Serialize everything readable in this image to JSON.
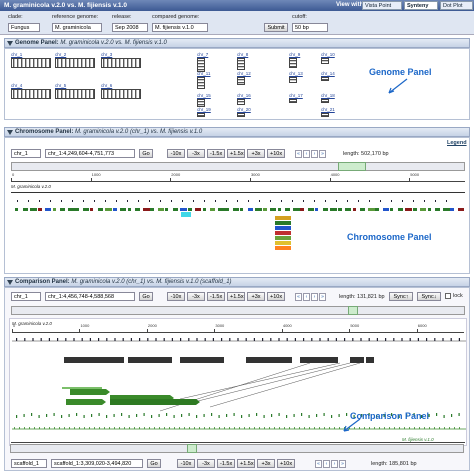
{
  "topbar": {
    "title": "M. graminicola v.2.0 vs. M. fijiensis v.1.0",
    "view_with": "View with:",
    "vista_point": "Vista Point",
    "synteny": "Synteny",
    "dot_plot": "Dot Plot"
  },
  "controls": {
    "clade_label": "clade:",
    "clade_value": "Fungus",
    "ref_label": "reference genome:",
    "ref_value": "M. graminicola",
    "release_label": "release:",
    "release_value": "Sep 2008",
    "compared_label": "compared genome:",
    "compared_value": "M. fijiensis v.1.0",
    "submit": "Submit",
    "cutoff_label": "cutoff:",
    "cutoff_value": "50 bp"
  },
  "genome_panel": {
    "title": "Genome Panel:",
    "subtitle": "M. graminicola v.2.0 vs. M. fijiensis v.1.0",
    "caption": "Genome Panel",
    "chromosomes": [
      "chr_1",
      "chr_2",
      "chr_3",
      "chr_4",
      "chr_5",
      "chr_6",
      "chr_7",
      "chr_8",
      "chr_9",
      "chr_10",
      "chr_11",
      "chr_12",
      "chr_13",
      "chr_14",
      "chr_15",
      "chr_16",
      "chr_17",
      "chr_18",
      "chr_19",
      "chr_20",
      "chr_21"
    ]
  },
  "chromosome_panel": {
    "title": "Chromosome Panel:",
    "subtitle": "M. graminicola v.2.0 (chr_1) vs. M. fijiensis v.1.0",
    "legend": "Legend",
    "chr_select": "chr_1",
    "range": "chr_1:4,249,604-4,751,773",
    "go": "Go",
    "zoom": [
      "-10x",
      "-3x",
      "-1.5x",
      "+1.5x",
      "+3x",
      "+10x"
    ],
    "length": "length: 502,170 bp",
    "track_label": "M. graminicola v.2.0",
    "ticks": [
      "0",
      "1000",
      "2000",
      "3000",
      "4000",
      "5000"
    ],
    "caption": "Chromosome Panel"
  },
  "comparison_panel": {
    "title": "Comparison Panel:",
    "subtitle": "M. graminicola v.2.0 (chr_1) vs. M. fijiensis v.1.0 (scaffold_1)",
    "chr_select": "chr_1",
    "range": "chr_1:4,456,748-4,588,568",
    "go": "Go",
    "zoom": [
      "-10x",
      "-3x",
      "-1.5x",
      "+1.5x",
      "+3x",
      "+10x"
    ],
    "length": "length: 131,821 bp",
    "sync_up": "Sync↑",
    "sync_down": "Sync↓",
    "lock": "lock",
    "track_label_top": "M. graminicola v.2.0",
    "track_label_bottom": "M. fijiensis v.1.0",
    "caption": "Comparison Panel",
    "scaffold_select": "scaffold_1",
    "scaffold_range": "scaffold_1:3,309,020-3,494,820",
    "scaffold_go": "Go",
    "scaffold_length": "length: 185,801 bp",
    "ticks_top": [
      "0",
      "1000",
      "2000",
      "3000",
      "4000",
      "5000",
      "6000"
    ],
    "ticks_bottom": [
      "0",
      "1000",
      "2000",
      "3000",
      "4000",
      "5000"
    ]
  },
  "colors": {
    "accent": "#1c67c8",
    "header_blue": "#3d5a93",
    "synteny_green": "#3a8a2a",
    "ref_block": "#333333"
  }
}
